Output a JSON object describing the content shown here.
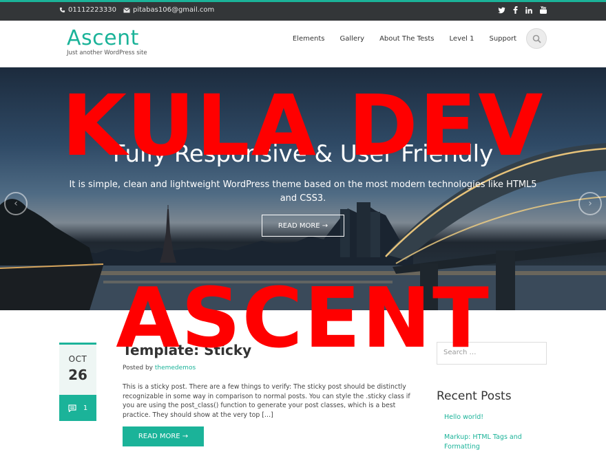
{
  "colors": {
    "accent": "#1bb399",
    "topbar": "#333638",
    "watermark": "#ff0000"
  },
  "topbar": {
    "phone_icon": "phone-icon",
    "phone": "01112223330",
    "email_icon": "envelope-icon",
    "email": "pitabas106@gmail.com",
    "social": [
      "twitter-icon",
      "facebook-icon",
      "linkedin-icon",
      "youtube-icon"
    ]
  },
  "header": {
    "logo": "Ascent",
    "tagline": "Just another WordPress site",
    "nav": [
      "Elements",
      "Gallery",
      "About The Tests",
      "Level 1",
      "Support"
    ],
    "search_icon": "search-icon"
  },
  "hero": {
    "title": "Fully Responsive & User Friendly",
    "description": "It is simple, clean and lightweight WordPress theme based on the most modern technologies like HTML5 and CSS3.",
    "button": "READ MORE →",
    "prev": "‹",
    "next": "›"
  },
  "post": {
    "month": "OCT",
    "day": "26",
    "comments": "1",
    "title": "Template: Sticky",
    "meta_prefix": "Posted by",
    "author": "themedemos",
    "excerpt": "This is a sticky post. There are a few things to verify: The sticky post should be distinctly recognizable in some way in comparison to normal posts. You can style the .sticky class if you are using the post_class() function to generate your post classes, which is a best practice. They should show at the very top […]",
    "read_more": "READ MORE →"
  },
  "sidebar": {
    "search_placeholder": "Search …",
    "recent_heading": "Recent Posts",
    "recent": [
      "Hello world!",
      "Markup: HTML Tags and Formatting"
    ]
  },
  "watermark": {
    "line1": "KULA DEV",
    "line2": "ASCENT"
  }
}
